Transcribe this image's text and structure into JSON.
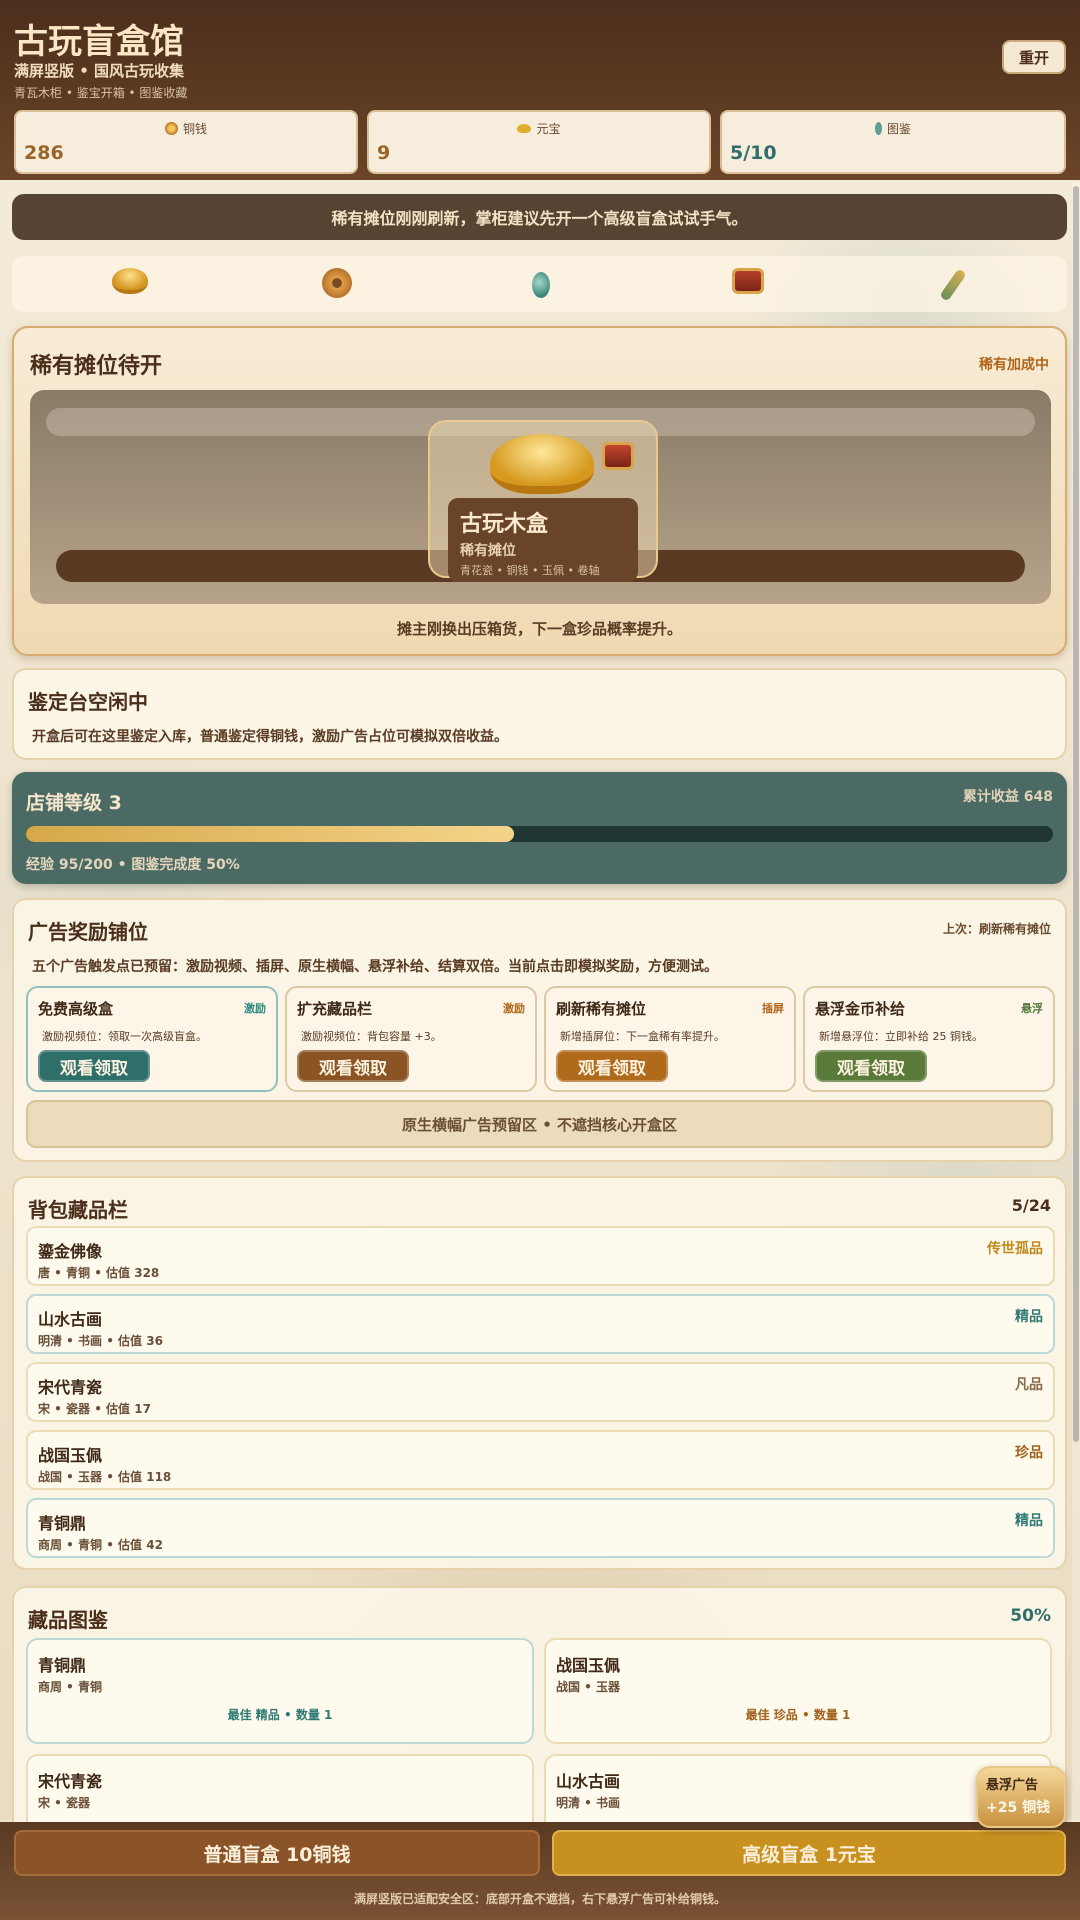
{
  "header": {
    "title": "古玩盲盒馆",
    "subtitle": "满屏竖版 • 国风古玩收集",
    "tagline": "青瓦木柜 • 鉴宝开箱 • 图鉴收藏",
    "restart_label": "重开"
  },
  "stats": [
    {
      "label": "铜钱",
      "value": "286",
      "icon": "coin-icon"
    },
    {
      "label": "元宝",
      "value": "9",
      "icon": "ingot-icon"
    },
    {
      "label": "图鉴",
      "value": "5/10",
      "icon": "jade-pendant-icon"
    }
  ],
  "notice": "稀有摊位刚刚刷新，掌柜建议先开一个高级盲盒试试手气。",
  "icon_strip": [
    "gold-ingot-icon",
    "copper-coin-icon",
    "jade-pendant-icon",
    "treasure-chest-icon",
    "jade-scepter-icon"
  ],
  "rare_stall": {
    "title": "稀有摊位待开",
    "badge": "稀有加成中",
    "box_name": "古玩木盒",
    "box_rarity": "稀有摊位",
    "box_contents": "青花瓷 • 铜钱 • 玉佩 • 卷轴",
    "caption": "摊主刚换出压箱货，下一盒珍品概率提升。"
  },
  "appraisal": {
    "title": "鉴定台空闲中",
    "desc": "开盒后可在这里鉴定入库，普通鉴定得铜钱，激励广告占位可模拟双倍收益。"
  },
  "shop_level": {
    "title": "店铺等级 3",
    "earnings": "累计收益 648",
    "progress": 0.475,
    "meta": "经验 95/200 • 图鉴完成度 50%"
  },
  "ads": {
    "title": "广告奖励铺位",
    "last": "上次：刷新稀有摊位",
    "desc": "五个广告触发点已预留：激励视频、插屏、原生横幅、悬浮补给、结算双倍。当前点击即模拟奖励，方便测试。",
    "cards": [
      {
        "name": "免费高级盒",
        "tag": "激励",
        "desc": "激励视频位：领取一次高级盲盒。",
        "button": "观看领取",
        "color": "#2f6f6a",
        "tag_color": "#2f8a80"
      },
      {
        "name": "扩充藏品栏",
        "tag": "激励",
        "desc": "激励视频位：背包容量 +3。",
        "button": "观看领取",
        "color": "#8a5424",
        "tag_color": "#b0651a"
      },
      {
        "name": "刷新稀有摊位",
        "tag": "插屏",
        "desc": "新增插屏位：下一盒稀有率提升。",
        "button": "观看领取",
        "color": "#b06a1c",
        "tag_color": "#b0651a"
      },
      {
        "name": "悬浮金币补给",
        "tag": "悬浮",
        "desc": "新增悬浮位：立即补给 25 铜钱。",
        "button": "观看领取",
        "color": "#5a7a3a",
        "tag_color": "#4f7a3a"
      }
    ],
    "banner": "原生横幅广告预留区 • 不遮挡核心开盒区"
  },
  "bag": {
    "title": "背包藏品栏",
    "count": "5/24",
    "items": [
      {
        "name": "鎏金佛像",
        "meta": "唐 • 青铜 • 估值 328",
        "grade": "传世孤品",
        "color": "#c08a1a"
      },
      {
        "name": "山水古画",
        "meta": "明清 • 书画 • 估值 36",
        "grade": "精品",
        "color": "#2f7a74"
      },
      {
        "name": "宋代青瓷",
        "meta": "宋 • 瓷器 • 估值 17",
        "grade": "凡品",
        "color": "#8a6a4a"
      },
      {
        "name": "战国玉佩",
        "meta": "战国 • 玉器 • 估值 118",
        "grade": "珍品",
        "color": "#a0621c"
      },
      {
        "name": "青铜鼎",
        "meta": "商周 • 青铜 • 估值 42",
        "grade": "精品",
        "color": "#2f7a74"
      }
    ]
  },
  "codex": {
    "title": "藏品图鉴",
    "percent": "50%",
    "cards": [
      {
        "name": "青铜鼎",
        "meta": "商周 • 青铜",
        "best": "最佳 精品 • 数量 1",
        "color": "#2f7a74"
      },
      {
        "name": "战国玉佩",
        "meta": "战国 • 玉器",
        "best": "最佳 珍品 • 数量 1",
        "color": "#a0621c"
      },
      {
        "name": "宋代青瓷",
        "meta": "宋 • 瓷器",
        "best": "",
        "color": "#8a6a4a"
      },
      {
        "name": "山水古画",
        "meta": "明清 • 书画",
        "best": "",
        "color": "#2f7a74"
      }
    ]
  },
  "float_ad": {
    "title": "悬浮广告",
    "value": "+25 铜钱"
  },
  "bottom": {
    "normal_label": "普通盲盒 10铜钱",
    "premium_label": "高级盲盒 1元宝",
    "note": "满屏竖版已适配安全区：底部开盒不遮挡，右下悬浮广告可补给铜钱。"
  }
}
